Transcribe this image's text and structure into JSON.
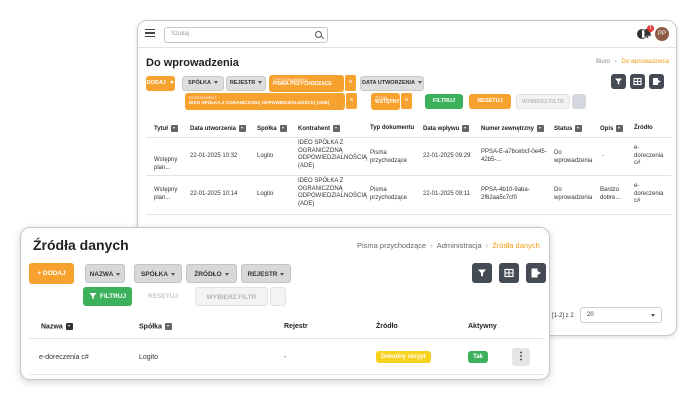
{
  "back_window": {
    "search_placeholder": "Szukaj",
    "notif_count": "1",
    "avatar_initials": "PP",
    "title": "Do wprowadzenia",
    "breadcrumb": {
      "first": "Biuro",
      "sep": "›",
      "current": "Do wprowadzenia"
    },
    "toolbar": {
      "add": "DODAJ",
      "spolka": "SPÓŁKA",
      "rejestr": "REJESTR",
      "chip1_small": "TYP DOKUMENTU",
      "chip1_big": "PISMA PRZYCHODZĄCE",
      "data_utworzenia": "DATA UTWORZENIA",
      "chip2_small": "KONTRAHENT",
      "chip2_big": "IDEO SPÓŁKA Z OGRANICZONĄ ODPOWIEDZIALNOŚCIĄ (ADE)",
      "chip3_small": "TYTUŁ",
      "chip3_big": "WSTĘPNY",
      "filter": "FILTRUJ",
      "reset": "RESETUJ",
      "select_filter": "WYBIERZ FILTR",
      "close": "×"
    },
    "columns": [
      "Tytuł",
      "Data utworzenia",
      "Spółka",
      "Kontrahent",
      "Typ dokumentu",
      "Data wpływu",
      "Numer zewnętrzny",
      "Status",
      "Opis",
      "Źródło"
    ],
    "rows": [
      {
        "tytul": "Wstępny plan...",
        "data": "22-01-2025 10:32",
        "spolka": "Logito",
        "kontrahent": "IDEO SPÓŁKA Z OGRANICZONĄ ODPOWIEDZIALNOŚCIĄ (ADE)",
        "typ": "Pisma przychodzące",
        "wplyw": "22-01-2025 09:29",
        "numer": "PPSA-E-a7bcebcf-0e45-42b5-...",
        "status": "Do wprowadzenia",
        "opis": "-",
        "zrodlo": "e-doreczenia c#"
      },
      {
        "tytul": "Wstępny plan...",
        "data": "22-01-2025 10:14",
        "spolka": "Logito",
        "kontrahent": "IDEO SPÓŁKA Z OGRANICZONĄ ODPOWIEDZIALNOŚCIĄ (ADE)",
        "typ": "Pisma przychodzące",
        "wplyw": "22-01-2025 09:11",
        "numer": "PPSA-4b10-9aba-2f62aa5c7cf0",
        "status": "Do wprowadzenia",
        "opis": "Bardzo dobre...",
        "zrodlo": "e-doreczenia c#"
      }
    ],
    "pagination": {
      "range": "[1-2] z 2",
      "per_page": "20"
    }
  },
  "front_window": {
    "title": "Źródła danych",
    "breadcrumb": {
      "first": "Pisma przychodzące",
      "second": "Administracja",
      "current": "Źródła danych",
      "sep": "›"
    },
    "toolbar": {
      "add": "+ DODAJ",
      "nazwa": "NAZWA",
      "spolka": "SPÓŁKA",
      "zrodlo": "ŹRÓDŁO",
      "rejestr": "REJESTR",
      "filter": "FILTRUJ",
      "reset": "RESETUJ",
      "select_filter": "WYBIERZ FILTR"
    },
    "columns": [
      "Nazwa",
      "Spółka",
      "Rejestr",
      "Źródło",
      "Aktywny"
    ],
    "rows": [
      {
        "nazwa": "e-doreczenia c#",
        "spolka": "Logito",
        "rejestr": "-",
        "zrodlo": "Dowolny skrypt",
        "aktywny": "Tak"
      }
    ]
  },
  "colors": {
    "accent": "#f7a12f",
    "green": "#3cb15c",
    "dark_button": "#454b54",
    "yellow_tag": "#f6d21c"
  },
  "icons": [
    "menu-icon",
    "search-icon",
    "theme-toggle-icon",
    "bell-icon",
    "filter-icon",
    "grid-icon",
    "export-icon",
    "kebab-icon",
    "chevron-down-icon"
  ]
}
